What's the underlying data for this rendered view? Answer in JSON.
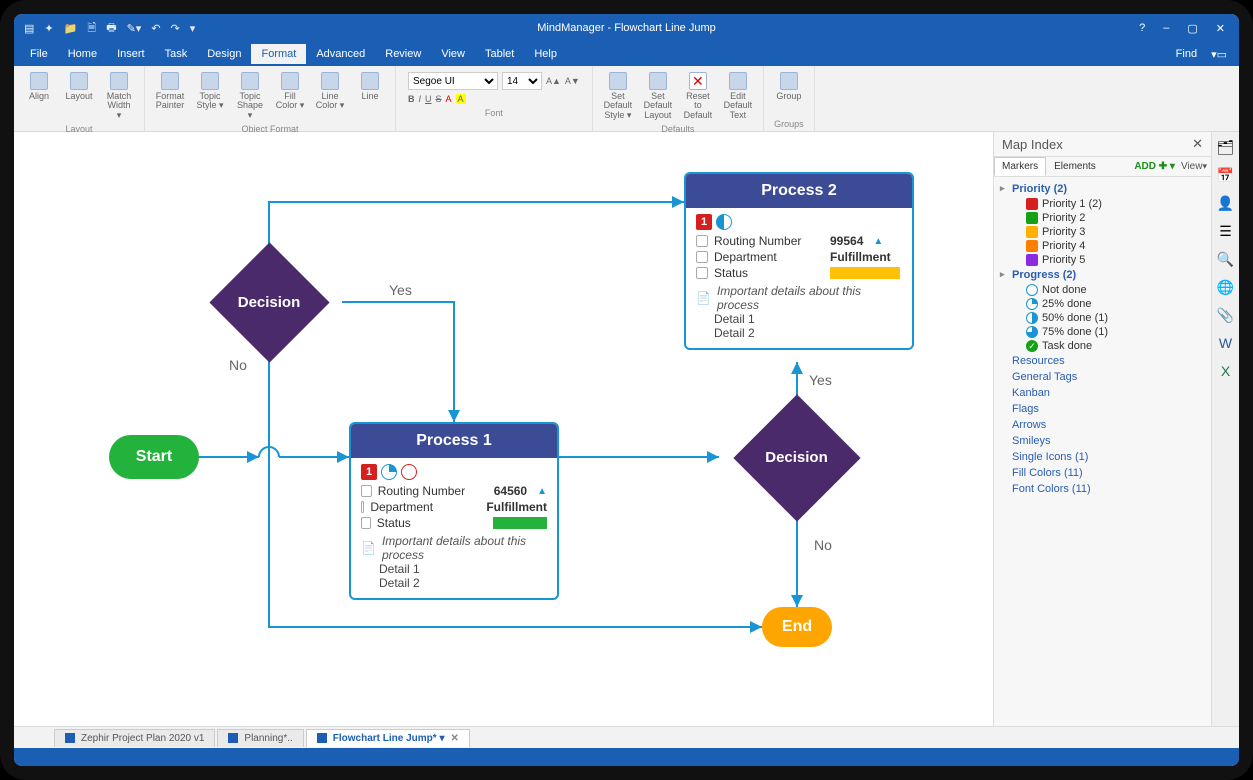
{
  "app_title": "MindManager - Flowchart Line Jump",
  "titlebar": {
    "minimize": "–",
    "restore": "▢",
    "close": "✕",
    "help": "?"
  },
  "menu": {
    "items": [
      "File",
      "Home",
      "Insert",
      "Task",
      "Design",
      "Format",
      "Advanced",
      "Review",
      "View",
      "Tablet",
      "Help"
    ],
    "active": "Format",
    "find": "Find"
  },
  "ribbon": {
    "groups": [
      {
        "name": "Layout",
        "buttons": [
          "Align",
          "Layout",
          "Match Width ▾"
        ]
      },
      {
        "name": "Object Format",
        "buttons": [
          "Format Painter",
          "Topic Style ▾",
          "Topic Shape ▾",
          "Fill Color ▾",
          "Line Color ▾",
          "Line"
        ]
      },
      {
        "name": "Font",
        "font": "Segoe UI",
        "size": "14",
        "buttons": [
          "B",
          "I",
          "U",
          "S",
          "A",
          "A"
        ],
        "grow": "A▲",
        "shrink": "A▼"
      },
      {
        "name": "Defaults",
        "buttons": [
          "Set Default Style ▾",
          "Set Default Layout",
          "Reset to Default",
          "Edit Default Text"
        ]
      },
      {
        "name": "Groups",
        "buttons": [
          "Group"
        ]
      }
    ]
  },
  "flow": {
    "start": "Start",
    "end": "End",
    "decision": "Decision",
    "yes": "Yes",
    "no": "No",
    "process1": {
      "title": "Process 1",
      "routing_k": "Routing Number",
      "routing_v": "64560",
      "dept_k": "Department",
      "dept_v": "Fulfillment",
      "status_k": "Status",
      "note": "Important details about this process",
      "d1": "Detail 1",
      "d2": "Detail 2"
    },
    "process2": {
      "title": "Process 2",
      "routing_k": "Routing Number",
      "routing_v": "99564",
      "dept_k": "Department",
      "dept_v": "Fulfillment",
      "status_k": "Status",
      "note": "Important details about this process",
      "d1": "Detail 1",
      "d2": "Detail 2"
    }
  },
  "panel": {
    "title": "Map Index",
    "tab_markers": "Markers",
    "tab_elements": "Elements",
    "add": "ADD",
    "view": "View",
    "priority": {
      "label": "Priority (2)",
      "items": [
        "Priority 1 (2)",
        "Priority 2",
        "Priority 3",
        "Priority 4",
        "Priority 5"
      ],
      "colors": [
        "#d71f1f",
        "#16a016",
        "#ffb000",
        "#ff7f00",
        "#8a2be2"
      ]
    },
    "progress": {
      "label": "Progress (2)",
      "items": [
        "Not done",
        "25% done",
        "50% done (1)",
        "75% done (1)",
        "Task done"
      ]
    },
    "links": [
      "Resources",
      "General Tags",
      "Kanban",
      "Flags",
      "Arrows",
      "Smileys",
      "Single Icons (1)",
      "Fill Colors (11)",
      "Font Colors (11)"
    ]
  },
  "doctabs": {
    "items": [
      "Zephir Project Plan 2020 v1",
      "Planning*..",
      "Flowchart Line Jump* ▾"
    ],
    "active": 2
  }
}
